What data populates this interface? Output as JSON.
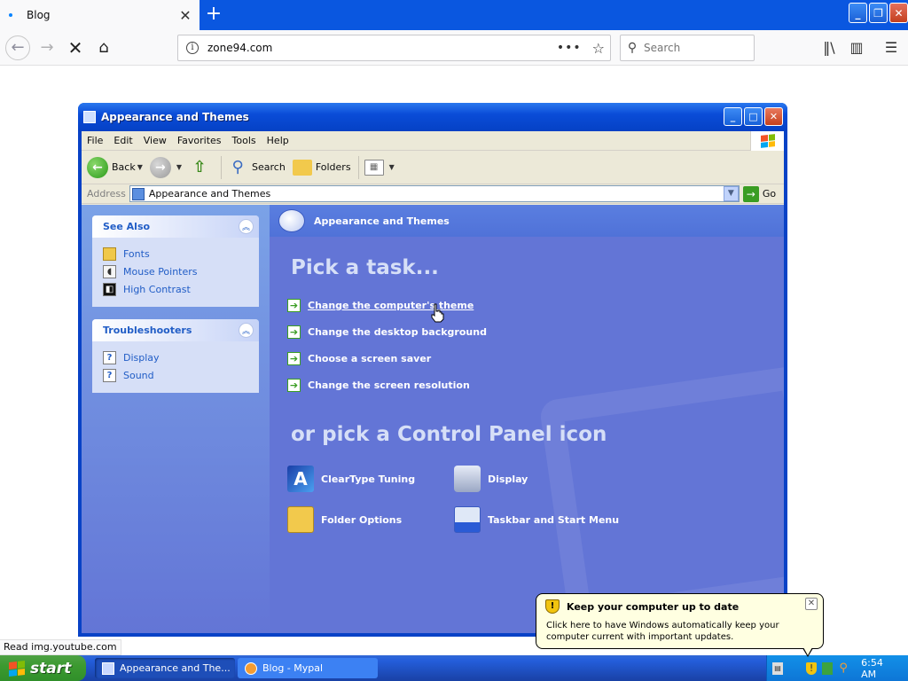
{
  "browser": {
    "tab_title": "Blog",
    "new_tab_symbol": "+",
    "url": "zone94.com",
    "search_placeholder": "Search",
    "status_text": "Read img.youtube.com"
  },
  "xp_window": {
    "title": "Appearance and Themes",
    "menus": [
      "File",
      "Edit",
      "View",
      "Favorites",
      "Tools",
      "Help"
    ],
    "toolbar": {
      "back_label": "Back",
      "search_label": "Search",
      "folders_label": "Folders"
    },
    "address": {
      "label": "Address",
      "value": "Appearance and Themes",
      "go_label": "Go"
    },
    "see_also": {
      "title": "See Also",
      "items": [
        {
          "label": "Fonts",
          "icon": "fonts-icon"
        },
        {
          "label": "Mouse Pointers",
          "icon": "mouse-icon"
        },
        {
          "label": "High Contrast",
          "icon": "high-contrast-icon"
        }
      ]
    },
    "troubleshooters": {
      "title": "Troubleshooters",
      "items": [
        {
          "label": "Display",
          "icon": "help-icon"
        },
        {
          "label": "Sound",
          "icon": "help-icon"
        }
      ]
    },
    "main": {
      "header": "Appearance and Themes",
      "pick_task": "Pick a task...",
      "tasks": [
        "Change the computer's theme",
        "Change the desktop background",
        "Choose a screen saver",
        "Change the screen resolution"
      ],
      "pick_icon": "or pick a Control Panel icon",
      "icons": [
        {
          "label": "ClearType Tuning",
          "icon": "cleartype-icon"
        },
        {
          "label": "Display",
          "icon": "display-icon"
        },
        {
          "label": "Folder Options",
          "icon": "folder-options-icon"
        },
        {
          "label": "Taskbar and Start Menu",
          "icon": "taskbar-icon"
        }
      ]
    }
  },
  "taskbar": {
    "start_label": "start",
    "buttons": [
      {
        "label": "Appearance and The...",
        "active": true
      },
      {
        "label": "Blog - Mypal",
        "active": false
      }
    ],
    "clock": "6:54 AM"
  },
  "balloon": {
    "title": "Keep your computer up to date",
    "text": "Click here to have Windows automatically keep your computer current with important updates."
  },
  "colors": {
    "xp_blue": "#0842c6",
    "task_pane_blue": "#6375d6",
    "link_blue": "#215dc6",
    "start_green": "#3c9a30",
    "balloon_bg": "#ffffe1"
  }
}
